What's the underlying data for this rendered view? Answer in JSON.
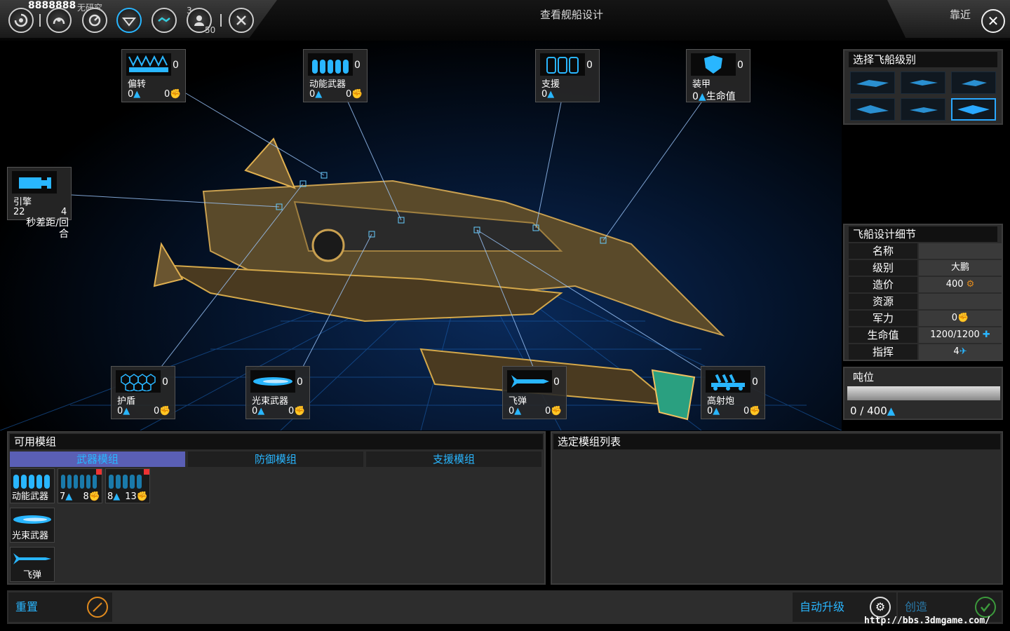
{
  "topbar": {
    "counter": "8888888",
    "research_status": "无研究",
    "icon_badge_top": "3",
    "icon_badge_bottom": "50",
    "title": "查看舰船设计",
    "zoom_label": "靠近"
  },
  "slots": {
    "deflect": {
      "count": "0",
      "label": "偏转",
      "val1": "0",
      "val2": "0"
    },
    "kinetic": {
      "count": "0",
      "label": "动能武器",
      "val1": "0",
      "val2": "0"
    },
    "support": {
      "count": "0",
      "label": "支援",
      "val1": "0"
    },
    "armor": {
      "count": "0",
      "label": "装甲",
      "val1": "0",
      "val2": "生命值"
    },
    "engine": {
      "label": "引擎",
      "val1": "22",
      "val2": "4",
      "note": "秒差距/回合"
    },
    "shield": {
      "count": "0",
      "label": "护盾",
      "val1": "0",
      "val2": "0"
    },
    "beam": {
      "count": "0",
      "label": "光束武器",
      "val1": "0",
      "val2": "0"
    },
    "missile": {
      "count": "0",
      "label": "飞弹",
      "val1": "0",
      "val2": "0"
    },
    "flak": {
      "count": "0",
      "label": "高射炮",
      "val1": "0",
      "val2": "0"
    }
  },
  "ship_class": {
    "title": "选择飞船级别",
    "selected_index": 5
  },
  "details": {
    "title": "飞船设计细节",
    "rows": [
      {
        "label": "名称",
        "value": ""
      },
      {
        "label": "级别",
        "value": "大鹏"
      },
      {
        "label": "造价",
        "value": "400"
      },
      {
        "label": "资源",
        "value": ""
      },
      {
        "label": "军力",
        "value": "0"
      },
      {
        "label": "生命值",
        "value": "1200/1200"
      },
      {
        "label": "指挥",
        "value": "4"
      }
    ]
  },
  "tonnage": {
    "title": "吨位",
    "value": "0 / 400",
    "fraction": 0
  },
  "available_modules": {
    "title": "可用模组",
    "tabs": [
      "武器模组",
      "防御模组",
      "支援模组"
    ],
    "active_tab": 0,
    "items": [
      {
        "label": "动能武器"
      },
      {
        "left": "7",
        "right": "8"
      },
      {
        "left": "8",
        "right": "13"
      },
      {
        "label": "光束武器"
      },
      {
        "label": "飞弹"
      }
    ]
  },
  "selected_modules": {
    "title": "选定模组列表"
  },
  "actions": {
    "reset": "重置",
    "auto_upgrade": "自动升级",
    "create": "创造"
  },
  "watermark": "http://bbs.3dmgame.com/",
  "colors": {
    "accent": "#29b6ff",
    "tab_active": "#5a5fb5",
    "create_check": "#3c9a3c",
    "reset_icon": "#e08a1e"
  }
}
